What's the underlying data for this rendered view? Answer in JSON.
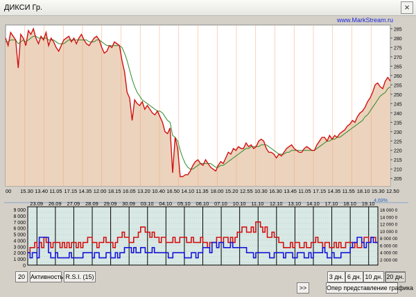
{
  "window": {
    "title": "ДИКСИ Гр.",
    "close_glyph": "×"
  },
  "watermark": "www.MarkStream.ru",
  "percent_label": "4,69%",
  "price_axis_ticks": [
    "285",
    "280",
    "275",
    "270",
    "265",
    "260",
    "255",
    "250",
    "245",
    "240",
    "235",
    "230",
    "225",
    "220",
    "215",
    "210",
    "205"
  ],
  "time_axis_ticks": [
    "00",
    "15.30",
    "13.40",
    "11.05",
    "17.15",
    "14.35",
    "12.00",
    "18.15",
    "16.05",
    "13.20",
    "10.40",
    "16.50",
    "14.10",
    "11.35",
    "18.00",
    "15.20",
    "12.55",
    "10.30",
    "16.30",
    "13.45",
    "11.05",
    "17.15",
    "14.35",
    "11.55",
    "18.10",
    "15.30",
    "12.50"
  ],
  "date_ticks": [
    "23.09",
    "26.09",
    "27.09",
    "28.09",
    "29.09",
    "30.09",
    "03.10",
    "04.10",
    "05.10",
    "06.10",
    "07.10",
    "10.10",
    "11.10",
    "12.10",
    "13.10",
    "14.10",
    "17.10",
    "18.10",
    "19.10"
  ],
  "volume_axis_left": [
    "9 000",
    "8 000",
    "7 000",
    "6 000",
    "5 000",
    "4 000",
    "3 000",
    "2 000",
    "1 000",
    "0"
  ],
  "volume_axis_right": [
    "16 000 0",
    "14 000 0",
    "12 000 0",
    "10 000 0",
    "8 000 00",
    "6 000 00",
    "4 000 00",
    "2 000 00"
  ],
  "buttons": {
    "period": "20",
    "activity": "Активность",
    "rsi": "R.S.I. (15)",
    "d3": "3 дн.",
    "d6": "6 дн.",
    "d10": "10 дн.",
    "d20": "20 дн.",
    "scroll": ">>",
    "view": "Опер представление графика"
  },
  "colors": {
    "price": "#d11010",
    "avg": "#2a8a2a",
    "fill": "#ecd3bd",
    "blue": "#1414d8",
    "panel": "#d8e8e5"
  },
  "chart_data": {
    "type": "line",
    "ylim": [
      201,
      287
    ],
    "series": [
      {
        "values": [
          280,
          276,
          283,
          281,
          279,
          264,
          282,
          280,
          276,
          284,
          282,
          285,
          280,
          277,
          281,
          279,
          283,
          276,
          280,
          278,
          275,
          273,
          276,
          279,
          280,
          281,
          278,
          280,
          277,
          280,
          282,
          279,
          277,
          276,
          278,
          280,
          281,
          279,
          275,
          272,
          273,
          276,
          275,
          278,
          277,
          276,
          268,
          262,
          251,
          248,
          236,
          247,
          245,
          244,
          246,
          242,
          244,
          242,
          240,
          239,
          241,
          238,
          235,
          230,
          229,
          232,
          208,
          227,
          221,
          206,
          206,
          207,
          207,
          209,
          212,
          214,
          215,
          213,
          212,
          215,
          213,
          211,
          210,
          209,
          212,
          214,
          213,
          216,
          219,
          218,
          221,
          220,
          222,
          221,
          221,
          224,
          222,
          223,
          221,
          222,
          225,
          226,
          225,
          221,
          219,
          219,
          218,
          216,
          218,
          217,
          219,
          221,
          222,
          223,
          221,
          220,
          219,
          219,
          221,
          222,
          221,
          220,
          220,
          223,
          225,
          227,
          227,
          225,
          228,
          226,
          228,
          227,
          229,
          230,
          231,
          233,
          234,
          236,
          235,
          238,
          240,
          241,
          243,
          246,
          248,
          251,
          255,
          256,
          254,
          253,
          257,
          259,
          257
        ]
      },
      {
        "values": [
          278,
          278,
          279,
          279,
          279,
          277,
          278,
          279,
          278,
          279,
          280,
          281,
          281,
          280,
          280,
          280,
          280,
          279,
          279,
          279,
          278,
          277,
          277,
          277,
          278,
          279,
          279,
          279,
          279,
          279,
          279,
          279,
          279,
          278,
          278,
          278,
          279,
          279,
          278,
          277,
          276,
          276,
          276,
          276,
          276,
          276,
          275,
          272,
          268,
          263,
          258,
          254,
          251,
          249,
          247,
          246,
          245,
          244,
          243,
          242,
          241,
          241,
          240,
          238,
          236,
          235,
          228,
          227,
          225,
          220,
          216,
          213,
          211,
          210,
          210,
          211,
          212,
          213,
          213,
          213,
          213,
          213,
          212,
          211,
          211,
          212,
          212,
          213,
          214,
          215,
          216,
          217,
          218,
          219,
          220,
          221,
          221,
          222,
          222,
          222,
          222,
          223,
          223,
          223,
          222,
          221,
          220,
          219,
          218,
          218,
          218,
          219,
          219,
          220,
          220,
          220,
          220,
          220,
          220,
          220,
          220,
          220,
          220,
          221,
          222,
          223,
          224,
          225,
          225,
          226,
          226,
          227,
          227,
          228,
          229,
          230,
          231,
          232,
          233,
          234,
          235,
          236,
          238,
          239,
          241,
          243,
          245,
          247,
          249,
          250,
          251,
          253,
          254
        ]
      }
    ],
    "indicator_series": [
      {
        "values": [
          2,
          3,
          3,
          4,
          3,
          4,
          3,
          5,
          4,
          4,
          3,
          4,
          4,
          4,
          3,
          4,
          3,
          4,
          3,
          4,
          4,
          3,
          4,
          3,
          4,
          4,
          5,
          5,
          4,
          4,
          3,
          4,
          4,
          5,
          4,
          4,
          4,
          3,
          4,
          5,
          5,
          6,
          5,
          5,
          4,
          4,
          5,
          5,
          6,
          7,
          7,
          6,
          6,
          5,
          6,
          5,
          5,
          4,
          5,
          5,
          4,
          4,
          4,
          5,
          4,
          4,
          5,
          5,
          5,
          4,
          4,
          5,
          4,
          4,
          4,
          5,
          4,
          4,
          3,
          4,
          4,
          4,
          5,
          5,
          4,
          5,
          5,
          4,
          5,
          4,
          5,
          6,
          6,
          7,
          7,
          6,
          6,
          7,
          6,
          8,
          8,
          7,
          6,
          7,
          5,
          5,
          6,
          5,
          5,
          4,
          4,
          3,
          3,
          3,
          4,
          3,
          4,
          4,
          3,
          3,
          4,
          3,
          3,
          4,
          4,
          5,
          4,
          4,
          3,
          4,
          4,
          3,
          3,
          4,
          3,
          4,
          3,
          3,
          4,
          4,
          4,
          3,
          4,
          3,
          3,
          4,
          5,
          5,
          4,
          5,
          5,
          4,
          4
        ]
      },
      {
        "values": [
          2,
          1,
          2,
          2,
          1,
          5,
          5,
          5,
          5,
          2,
          1,
          1,
          2,
          1,
          1,
          1,
          1,
          1,
          2,
          1,
          1,
          1,
          1,
          1,
          2,
          2,
          2,
          2,
          1,
          2,
          2,
          1,
          1,
          1,
          2,
          2,
          1,
          1,
          2,
          1,
          2,
          2,
          3,
          3,
          3,
          2,
          3,
          2,
          2,
          3,
          3,
          2,
          2,
          2,
          3,
          2,
          2,
          2,
          2,
          2,
          2,
          1,
          1,
          2,
          2,
          2,
          2,
          2,
          1,
          1,
          1,
          2,
          2,
          1,
          2,
          2,
          3,
          3,
          3,
          2,
          4,
          4,
          3,
          4,
          4,
          3,
          3,
          3,
          4,
          3,
          3,
          3,
          3,
          3,
          3,
          2,
          2,
          2,
          1,
          2,
          2,
          2,
          2,
          2,
          2,
          1,
          1,
          2,
          2,
          2,
          2,
          1,
          2,
          2,
          2,
          1,
          1,
          2,
          2,
          2,
          1,
          1,
          2,
          1,
          2,
          2,
          2,
          2,
          3,
          2,
          1,
          1,
          2,
          1,
          1,
          1,
          2,
          2,
          2,
          2,
          3,
          4,
          4,
          5,
          5,
          4,
          3,
          4,
          4,
          5,
          4,
          4,
          4
        ]
      }
    ]
  }
}
